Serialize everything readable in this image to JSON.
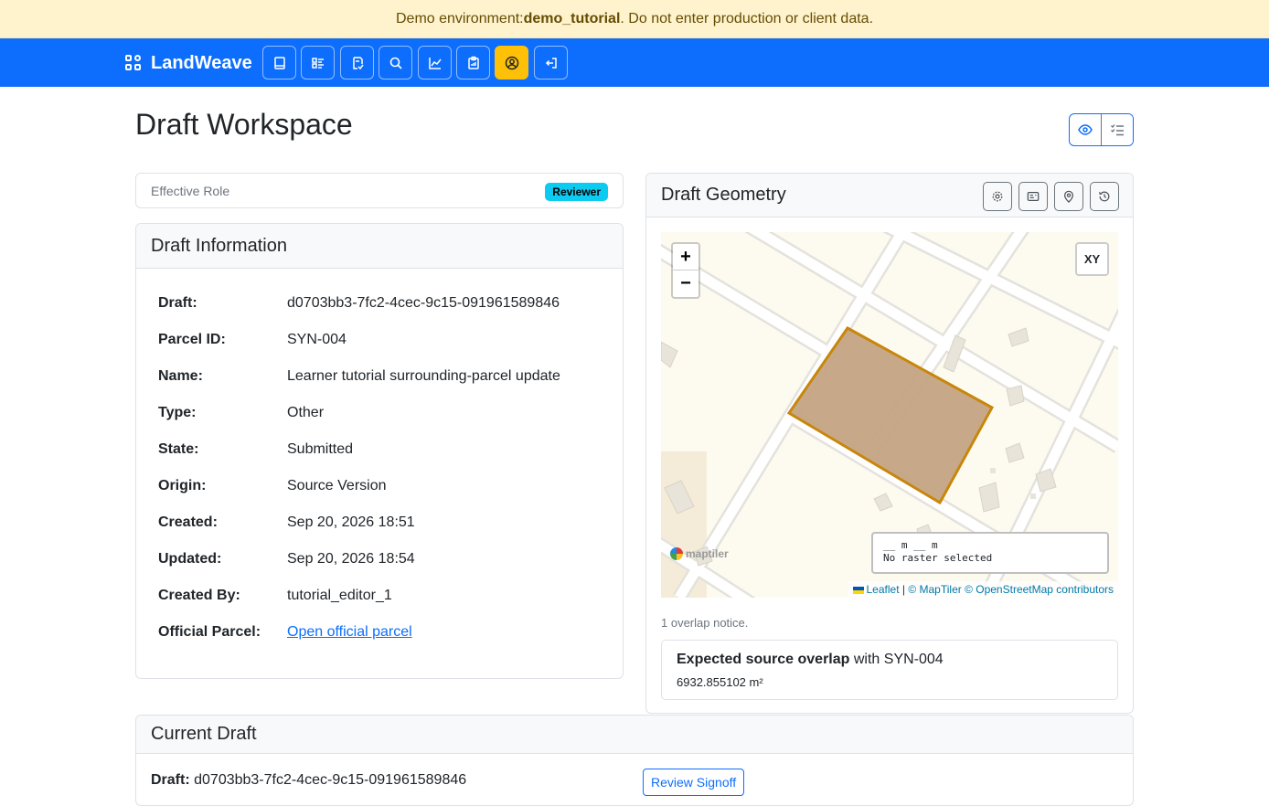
{
  "banner": {
    "prefix": "Demo environment: ",
    "env_name": "demo_tutorial",
    "suffix": ". Do not enter production or client data.",
    "color": "#fff3cd"
  },
  "navbar": {
    "brand": "LandWeave",
    "brand_icon": "grid-icon",
    "color": "#0d6efd",
    "buttons": [
      {
        "icon": "book-icon",
        "active": false
      },
      {
        "icon": "list-details-icon",
        "active": false
      },
      {
        "icon": "file-check-icon",
        "active": false
      },
      {
        "icon": "search-icon",
        "active": false
      },
      {
        "icon": "chart-icon",
        "active": false
      },
      {
        "icon": "clipboard-icon",
        "active": false
      },
      {
        "icon": "user-circle-icon",
        "active": true
      },
      {
        "icon": "logout-icon",
        "active": false
      }
    ]
  },
  "page": {
    "title": "Draft Workspace",
    "view_buttons": [
      "eye-icon",
      "checklist-icon"
    ]
  },
  "role": {
    "label": "Effective Role",
    "badge": "Reviewer"
  },
  "info": {
    "header": "Draft Information",
    "rows": [
      {
        "label": "Draft:",
        "value": "d0703bb3-7fc2-4cec-9c15-091961589846"
      },
      {
        "label": "Parcel ID:",
        "value": "SYN-004"
      },
      {
        "label": "Name:",
        "value": "Learner tutorial surrounding-parcel update"
      },
      {
        "label": "Type:",
        "value": "Other"
      },
      {
        "label": "State:",
        "value": "Submitted"
      },
      {
        "label": "Origin:",
        "value": "Source Version"
      },
      {
        "label": "Created:",
        "value": "Sep 20, 2026 18:51"
      },
      {
        "label": "Updated:",
        "value": "Sep 20, 2026 18:54"
      },
      {
        "label": "Created By:",
        "value": "tutorial_editor_1"
      },
      {
        "label": "Official Parcel:",
        "value": "Open official parcel"
      }
    ]
  },
  "geometry": {
    "header": "Draft Geometry",
    "tools": [
      "settings-icon",
      "id-card-icon",
      "map-pin-icon",
      "history-icon"
    ],
    "map": {
      "zoom_in": "+",
      "zoom_out": "−",
      "xy_button": "XY",
      "coord_line1": "__ m __ m",
      "coord_line2": "No raster selected",
      "maptiler": "maptiler",
      "attribution": {
        "leaflet": "Leaflet",
        "sep": " | ",
        "maptiler": "© MapTiler",
        "osm": "© OpenStreetMap contributors"
      },
      "parcel_fill": "#c4a484",
      "parcel_stroke": "#c8860a"
    },
    "overlap_count": "1 overlap notice.",
    "overlap": {
      "title": "Expected source overlap",
      "with": " with SYN-004",
      "area": "6932.855102 m²"
    }
  },
  "current": {
    "header": "Current Draft",
    "label": "Draft:",
    "value": " d0703bb3-7fc2-4cec-9c15-091961589846",
    "review_button": "Review Signoff"
  }
}
